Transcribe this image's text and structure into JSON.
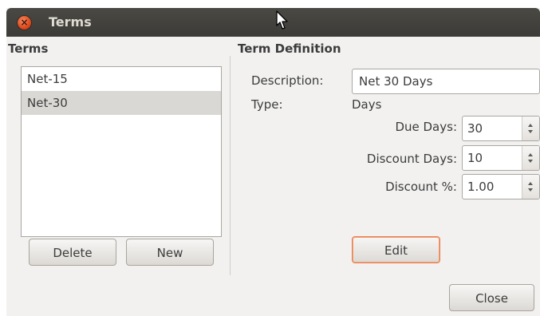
{
  "window": {
    "title": "Terms",
    "close_glyph": "×"
  },
  "terms_panel": {
    "heading": "Terms",
    "items": [
      {
        "label": "Net-15",
        "selected": false
      },
      {
        "label": "Net-30",
        "selected": true
      }
    ],
    "delete_label": "Delete",
    "new_label": "New"
  },
  "definition_panel": {
    "heading": "Term Definition",
    "description_label": "Description:",
    "description_value": "Net 30 Days",
    "type_label": "Type:",
    "type_value": "Days",
    "due_days_label": "Due Days:",
    "due_days_value": "30",
    "discount_days_label": "Discount Days:",
    "discount_days_value": "10",
    "discount_pct_label": "Discount %:",
    "discount_pct_value": "1.00",
    "edit_label": "Edit"
  },
  "footer": {
    "close_label": "Close"
  },
  "colors": {
    "titlebar": "#3c3b37",
    "close_button": "#e0481c",
    "focus_ring": "#e9814f",
    "selection": "#dad8d4"
  },
  "icons": {
    "close": "close-icon",
    "cursor": "mouse-pointer-icon",
    "spin_up": "chevron-up-icon",
    "spin_down": "chevron-down-icon"
  }
}
